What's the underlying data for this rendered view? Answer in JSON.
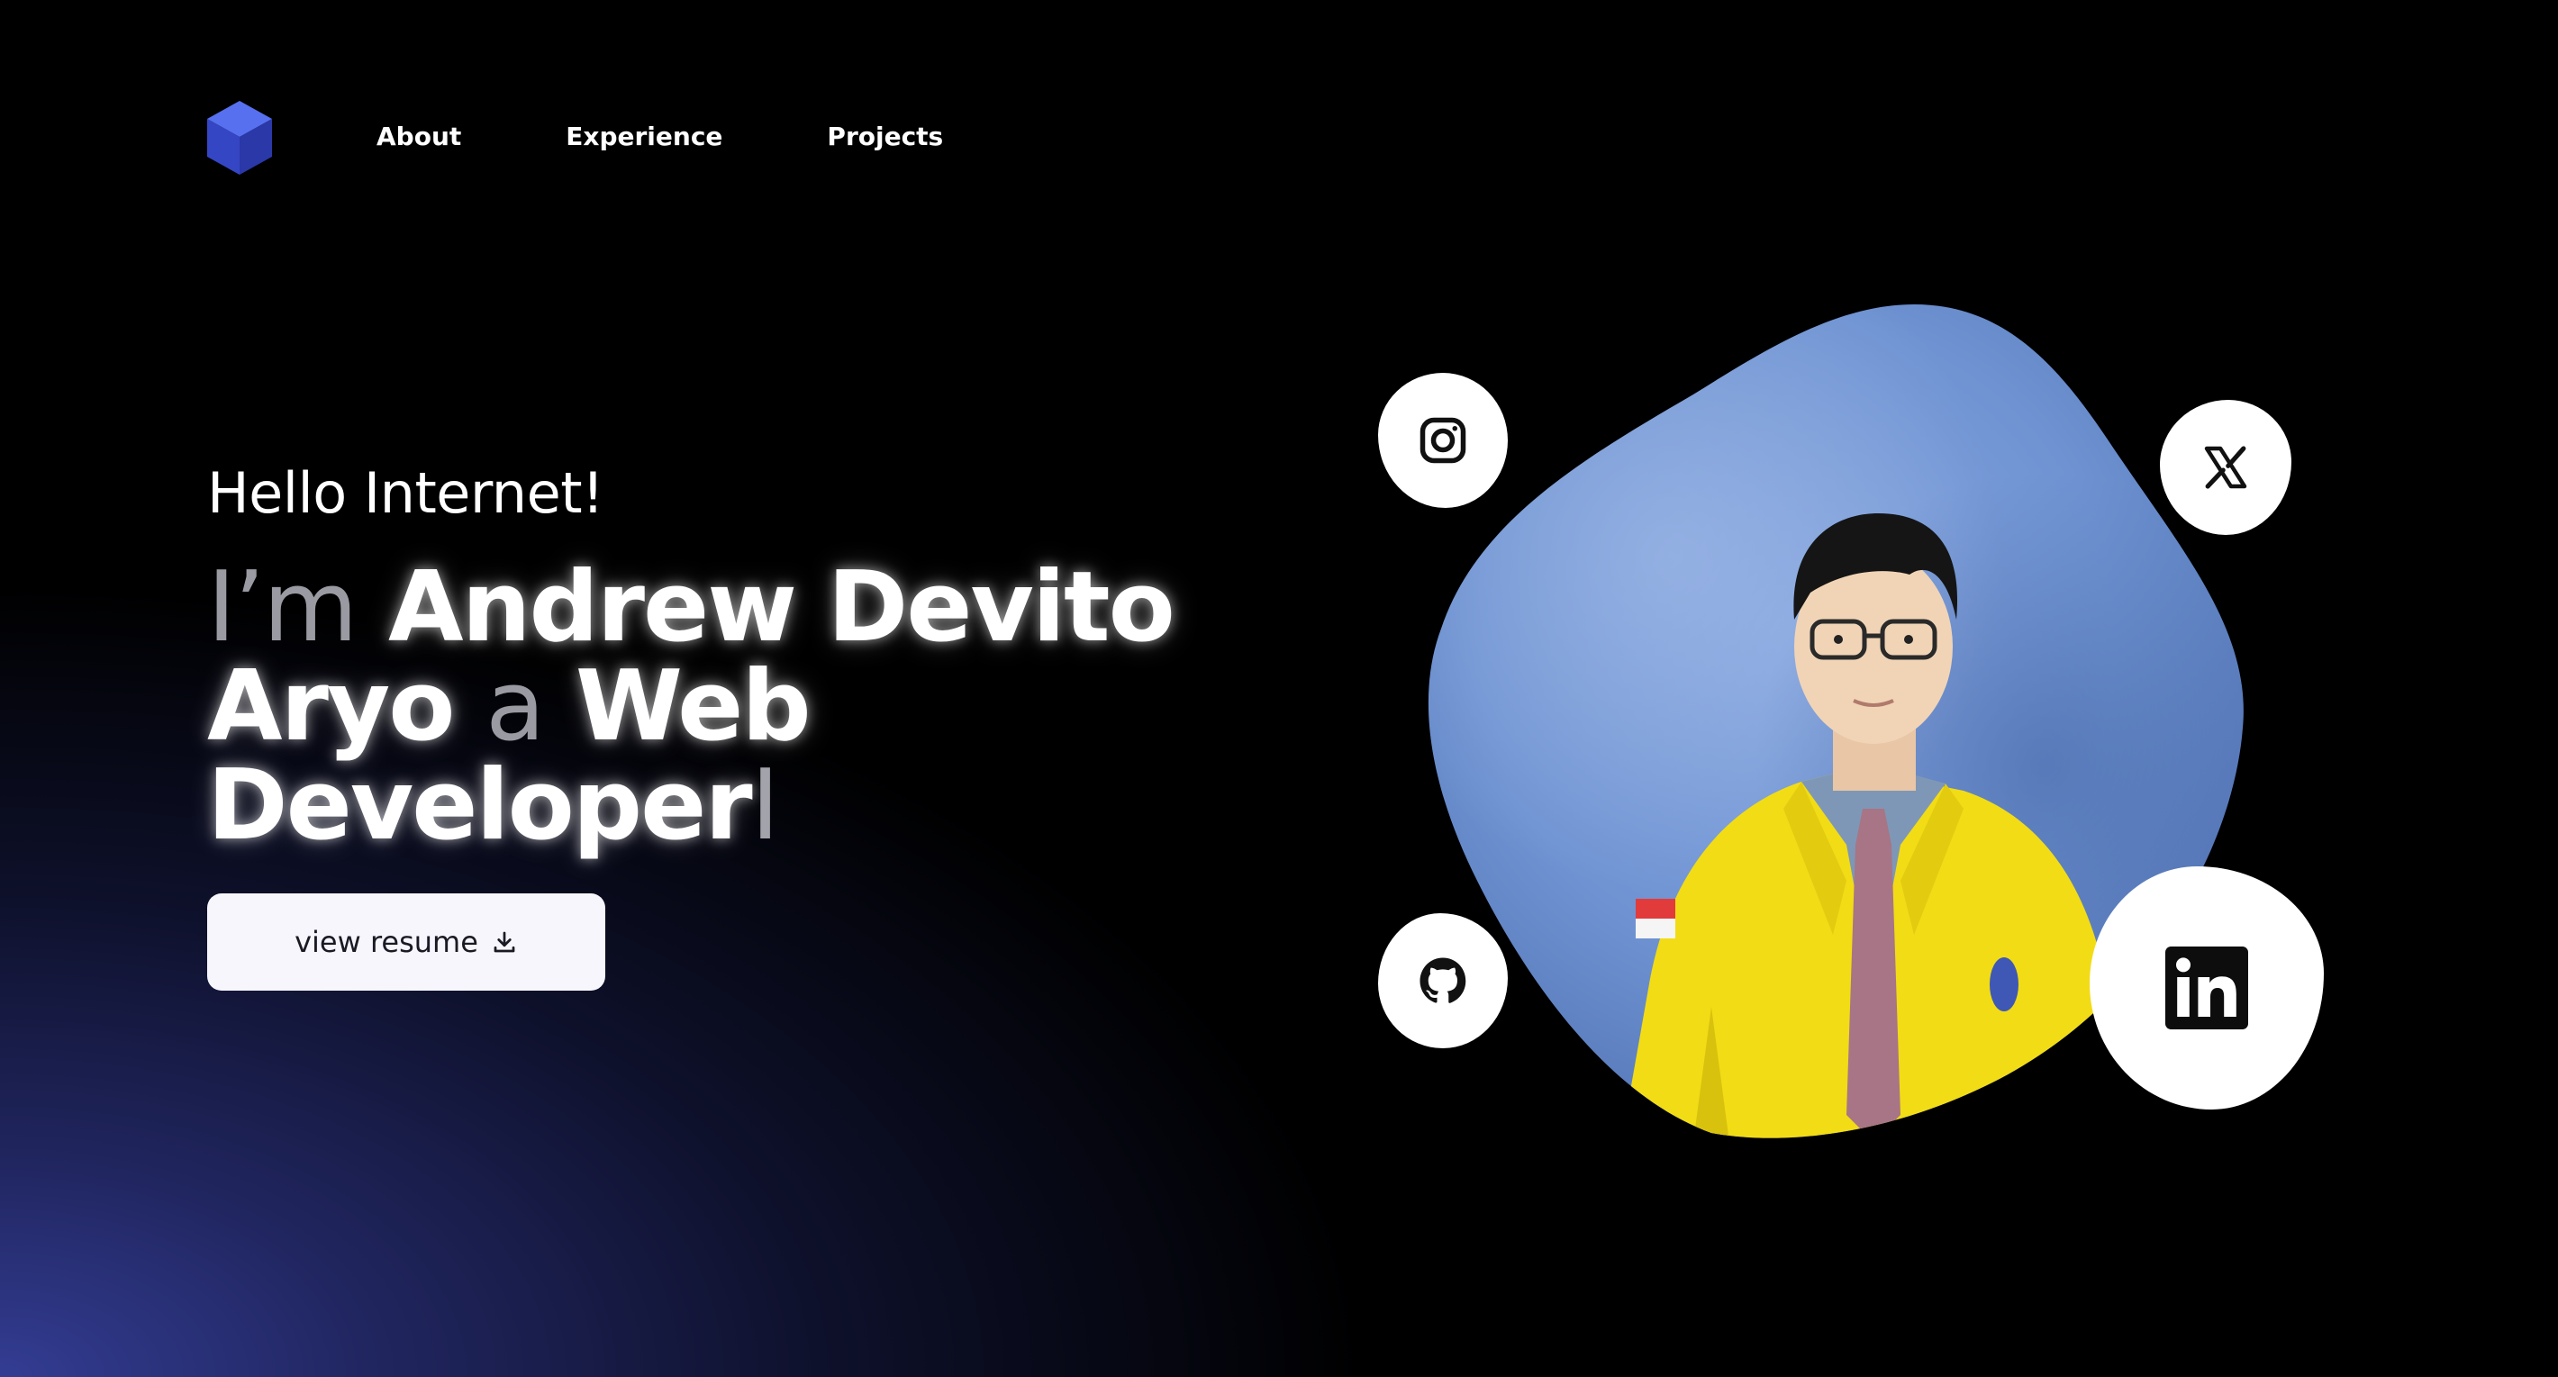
{
  "nav": {
    "logo_icon": "cube-logo-icon",
    "items": [
      {
        "label": "About"
      },
      {
        "label": "Experience"
      },
      {
        "label": "Projects"
      }
    ]
  },
  "hero": {
    "greeting": "Hello Internet!",
    "headline": {
      "prefix": "I’m",
      "name_line1": "Andrew Devito",
      "name_line2": "Aryo",
      "connector": "a",
      "role_line1": "Web",
      "role_line2": "Developer",
      "cursor": "I"
    },
    "resume_button": {
      "label": "view resume",
      "icon": "download-icon"
    }
  },
  "social": [
    {
      "name": "instagram",
      "icon": "instagram-icon"
    },
    {
      "name": "x",
      "icon": "x-icon"
    },
    {
      "name": "github",
      "icon": "github-icon"
    },
    {
      "name": "linkedin",
      "icon": "linkedin-icon"
    }
  ],
  "colors": {
    "background": "#000000",
    "gradient_accent": "#343e96",
    "logo_blue": "#3a50d6",
    "button_bg": "#f7f6fd",
    "portrait_bg": "#6f93d2",
    "jacket_yellow": "#f2dc15"
  }
}
